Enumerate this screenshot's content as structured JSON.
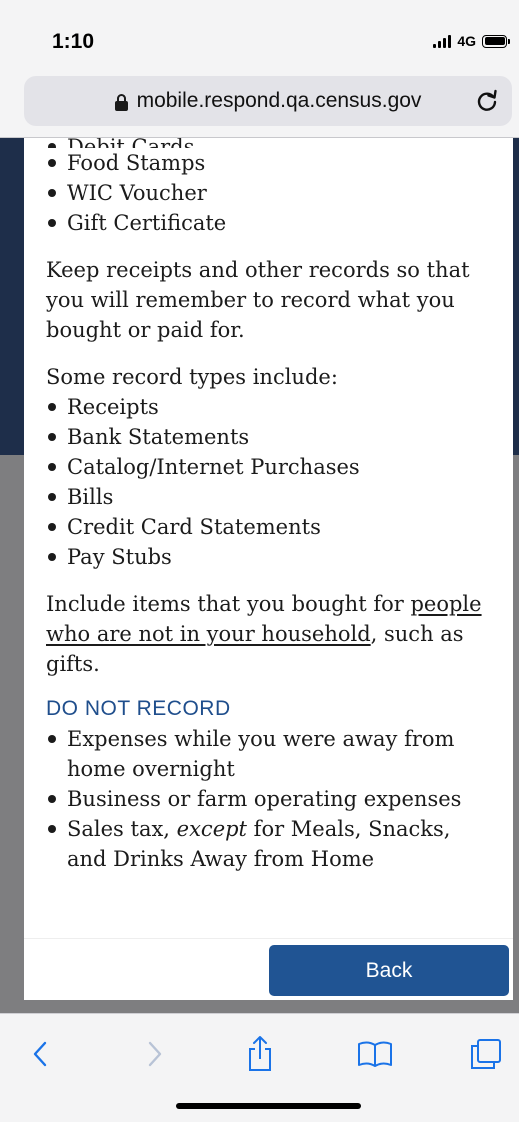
{
  "status_bar": {
    "time": "1:10",
    "network": "4G"
  },
  "browser": {
    "url": "mobile.respond.qa.census.gov"
  },
  "content": {
    "cut_off_item": "Debit Cards",
    "payment_items": [
      "Food Stamps",
      "WIC Voucher",
      "Gift Certificate"
    ],
    "receipts_paragraph": "Keep receipts and other records so that you will remember to record what you bought or paid for.",
    "record_types_intro": "Some record types include:",
    "record_types": [
      "Receipts",
      "Bank Statements",
      "Catalog/Internet Purchases",
      "Bills",
      "Credit Card Statements",
      "Pay Stubs"
    ],
    "include_prefix": "Include items that you bought for ",
    "include_link": "people who are not in your household",
    "include_suffix": ", such as gifts.",
    "do_not_record_heading": "DO NOT RECORD",
    "do_not_record_items": [
      "Expenses while you were away from home overnight",
      "Business or farm operating expenses"
    ],
    "sales_tax_prefix": "Sales tax, ",
    "sales_tax_emphasis": "except",
    "sales_tax_suffix": " for Meals, Snacks, and Drinks Away from Home"
  },
  "footer": {
    "back_label": "Back"
  },
  "toolbar": {
    "icons": [
      "back-icon",
      "forward-icon",
      "share-icon",
      "bookmarks-icon",
      "tabs-icon"
    ]
  },
  "colors": {
    "heading": "#1f4e8c",
    "button": "#205493",
    "backdrop": "#1e2e4a"
  }
}
